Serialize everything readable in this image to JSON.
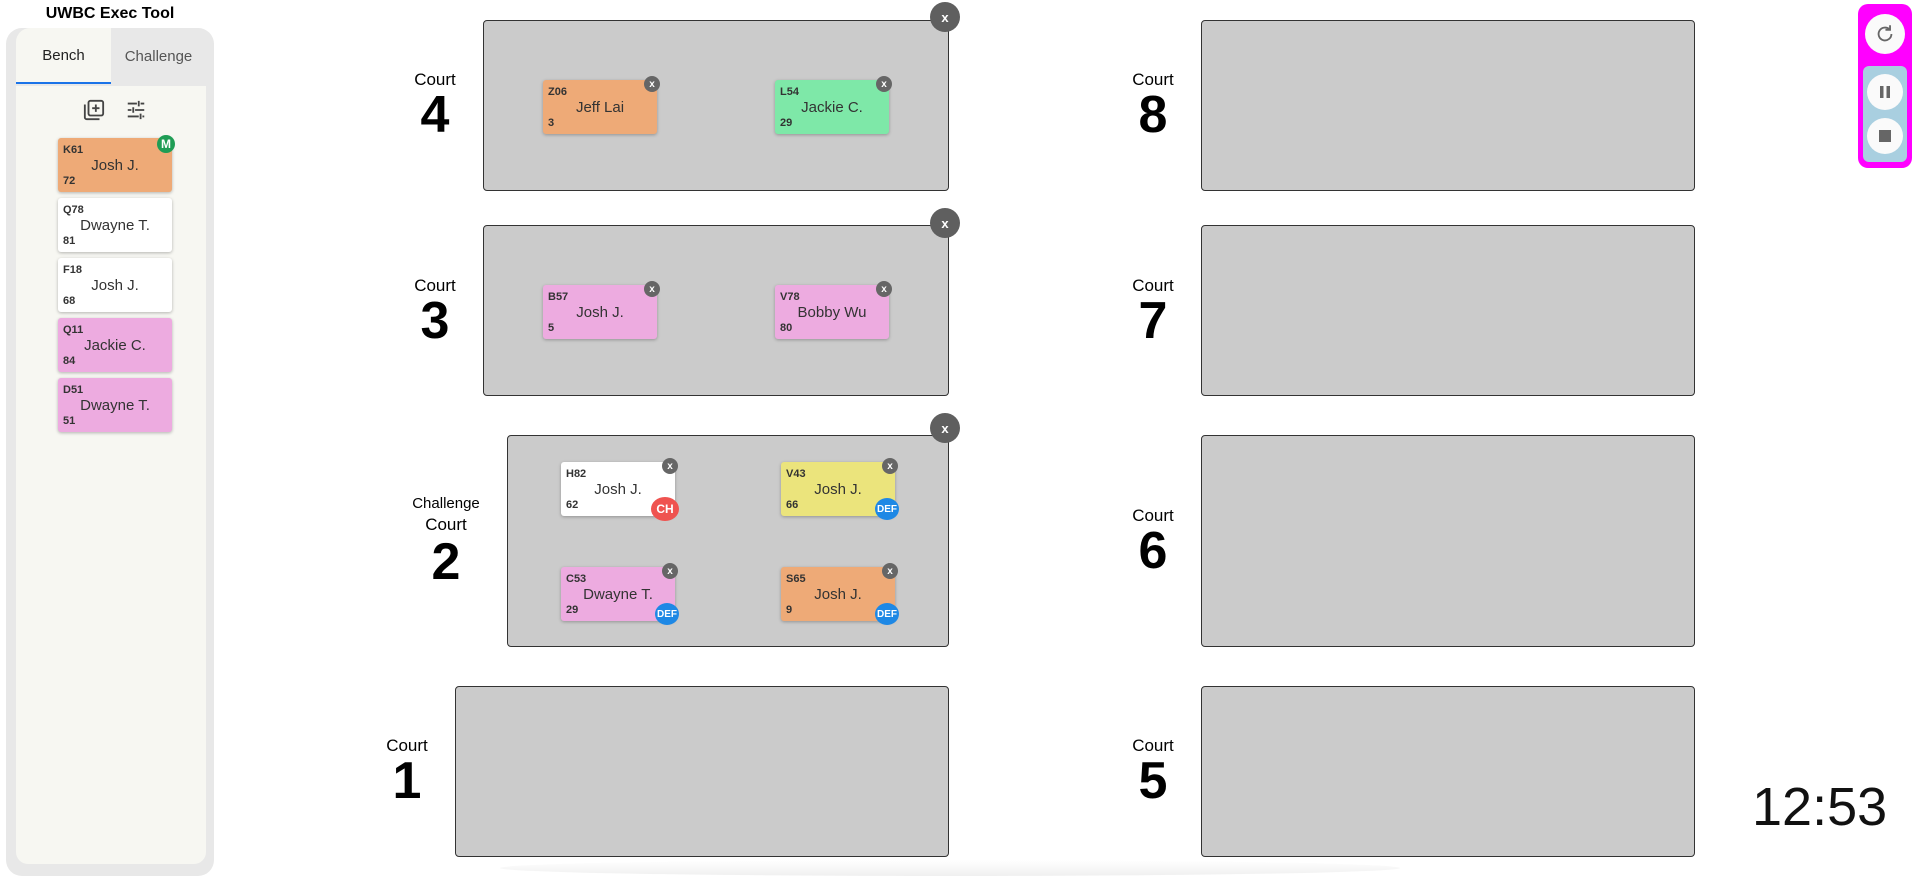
{
  "app": {
    "title": "UWBC Exec Tool"
  },
  "sidebar": {
    "tabs": [
      {
        "label": "Bench"
      },
      {
        "label": "Challenge"
      }
    ],
    "toolbar": {
      "add_icon": "add-box-icon",
      "settings_icon": "tune-icon"
    },
    "bench_cards": [
      {
        "id": "K61",
        "name": "Josh J.",
        "num": "72",
        "color": "#eeaa77",
        "badge": "M"
      },
      {
        "id": "Q78",
        "name": "Dwayne T.",
        "num": "81",
        "color": "#ffffff"
      },
      {
        "id": "F18",
        "name": "Josh J.",
        "num": "68",
        "color": "#ffffff"
      },
      {
        "id": "Q11",
        "name": "Jackie C.",
        "num": "84",
        "color": "#edabe0"
      },
      {
        "id": "D51",
        "name": "Dwayne T.",
        "num": "51",
        "color": "#edabe0"
      }
    ]
  },
  "courts": {
    "court4": {
      "word": "Court",
      "num": "4",
      "remove": "x",
      "players": [
        {
          "id": "Z06",
          "name": "Jeff Lai",
          "num": "3",
          "color": "#eeaa77",
          "remove": "x"
        },
        {
          "id": "L54",
          "name": "Jackie C.",
          "num": "29",
          "color": "#7ee8a8",
          "remove": "x"
        }
      ]
    },
    "court3": {
      "word": "Court",
      "num": "3",
      "remove": "x",
      "players": [
        {
          "id": "B57",
          "name": "Josh J.",
          "num": "5",
          "color": "#edabe0",
          "remove": "x"
        },
        {
          "id": "V78",
          "name": "Bobby Wu",
          "num": "80",
          "color": "#edabe0",
          "remove": "x"
        }
      ]
    },
    "court2": {
      "prefix": "Challenge",
      "word": "Court",
      "num": "2",
      "remove": "x",
      "players": [
        {
          "id": "H82",
          "name": "Josh J.",
          "num": "62",
          "color": "#ffffff",
          "remove": "x",
          "badge": "CH"
        },
        {
          "id": "V43",
          "name": "Josh J.",
          "num": "66",
          "color": "#ebe47c",
          "remove": "x",
          "badge": "DEF"
        },
        {
          "id": "C53",
          "name": "Dwayne T.",
          "num": "29",
          "color": "#edabe0",
          "remove": "x",
          "badge": "DEF"
        },
        {
          "id": "S65",
          "name": "Josh J.",
          "num": "9",
          "color": "#eeaa77",
          "remove": "x",
          "badge": "DEF"
        }
      ]
    },
    "court1": {
      "word": "Court",
      "num": "1"
    },
    "court8": {
      "word": "Court",
      "num": "8"
    },
    "court7": {
      "word": "Court",
      "num": "7"
    },
    "court6": {
      "word": "Court",
      "num": "6"
    },
    "court5": {
      "word": "Court",
      "num": "5"
    }
  },
  "controls": {
    "reset_icon": "refresh-icon",
    "pause_icon": "pause-icon",
    "stop_icon": "stop-icon",
    "accent": "#ff00ff",
    "panel_color": "#a9cfe0"
  },
  "clock": {
    "time": "12:53"
  },
  "colors": {
    "court_bg": "#cbcbcb",
    "sidebar_bg": "#e8e8e8",
    "tab_underline": "#1a73e8"
  }
}
